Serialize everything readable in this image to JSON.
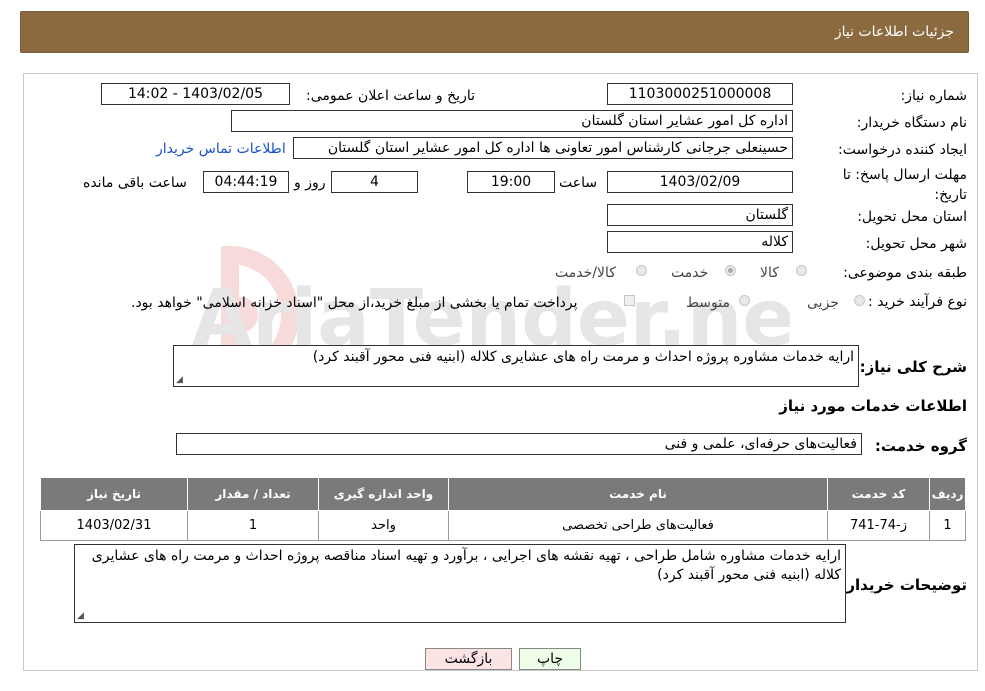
{
  "header": {
    "title": "جزئیات اطلاعات نیاز"
  },
  "watermark": {
    "text": "AriaTender.neT"
  },
  "form": {
    "need_number_label": "شماره نیاز:",
    "need_number": "1103000251000008",
    "announce_label": "تاریخ و ساعت اعلان عمومی:",
    "announce_value": "1403/02/05 - 14:02",
    "buyer_org_label": "نام دستگاه خریدار:",
    "buyer_org": "اداره کل امور عشایر استان گلستان",
    "creator_label": "ایجاد کننده درخواست:",
    "creator": "حسینعلی جرجانی کارشناس امور تعاونی ها اداره کل امور عشایر استان گلستان",
    "contact_link": "اطلاعات تماس خریدار",
    "deadline_label": "مهلت ارسال پاسخ: تا تاریخ:",
    "deadline_date": "1403/02/09",
    "time_label": "ساعت",
    "deadline_time": "19:00",
    "days_value": "4",
    "days_label": "روز و",
    "remaining_time": "04:44:19",
    "remaining_label": "ساعت باقی مانده",
    "province_label": "استان محل تحویل:",
    "province": "گلستان",
    "city_label": "شهر محل تحویل:",
    "city": "کلاله",
    "category_label": "طبقه بندی موضوعی:",
    "category_options": [
      "کالا",
      "خدمت",
      "کالا/خدمت"
    ],
    "purchase_type_label": "نوع فرآیند خرید :",
    "purchase_options": [
      "جزیی",
      "متوسط"
    ],
    "purchase_note": "پرداخت تمام یا بخشی از مبلغ خرید،از محل \"اسناد خزانه اسلامی\" خواهد بود."
  },
  "summary": {
    "label": "شرح کلی نیاز:",
    "text": "ارایه خدمات مشاوره پروژه احداث و مرمت راه های عشایری کلاله (ابنیه فنی محور آقبند کرد)"
  },
  "services": {
    "section_title": "اطلاعات خدمات مورد نیاز",
    "group_label": "گروه خدمت:",
    "group_value": "فعالیت‌های حرفه‌ای، علمی و فنی",
    "columns": [
      "ردیف",
      "کد خدمت",
      "نام خدمت",
      "واحد اندازه گیری",
      "تعداد / مقدار",
      "تاریخ نیاز"
    ],
    "rows": [
      [
        "1",
        "ز-74-741",
        "فعالیت‌های طراحی تخصصی",
        "واحد",
        "1",
        "1403/02/31"
      ]
    ]
  },
  "buyer_notes": {
    "label": "توضیحات خریدار:",
    "text": "ارایه خدمات مشاوره شامل طراحی ، تهیه نقشه های اجرایی ، برآورد و تهیه اسناد مناقصه پروژه احداث و مرمت راه های عشایری کلاله (ابنیه فنی محور آقبند کرد)"
  },
  "buttons": {
    "print": "چاپ",
    "back": "بازگشت"
  }
}
